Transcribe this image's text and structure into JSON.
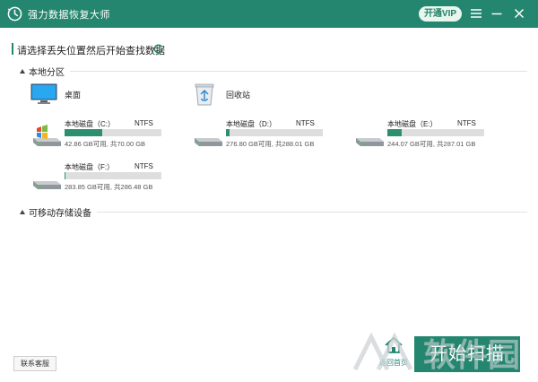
{
  "window": {
    "title": "强力数据恢复大师",
    "vip_label": "开通VIP",
    "logo_icon": "recovery-logo-icon",
    "menu_icon": "hamburger-menu-icon",
    "minimize_icon": "minimize-icon",
    "close_icon": "close-icon"
  },
  "header": {
    "prompt": "请选择丢失位置然后开始查找数据",
    "refresh_icon": "refresh-icon"
  },
  "local_section": {
    "label": "本地分区",
    "locations": [
      {
        "label": "桌面",
        "icon": "desktop-monitor-icon"
      },
      {
        "label": "回收站",
        "icon": "recycle-bin-icon"
      }
    ],
    "drives": [
      {
        "name": "本地磁盘（C:）",
        "fs": "NTFS",
        "size_text": "42.86 GB可用, 共70.00 GB",
        "used_fraction": 0.39,
        "icon": "windows-system-drive-icon"
      },
      {
        "name": "本地磁盘（D:）",
        "fs": "NTFS",
        "size_text": "276.80 GB可用, 共288.01 GB",
        "used_fraction": 0.04,
        "icon": "hard-drive-icon"
      },
      {
        "name": "本地磁盘（E:）",
        "fs": "NTFS",
        "size_text": "244.07 GB可用, 共287.01 GB",
        "used_fraction": 0.15,
        "icon": "hard-drive-icon"
      },
      {
        "name": "本地磁盘（F:）",
        "fs": "NTFS",
        "size_text": "283.85 GB可用, 共286.48 GB",
        "used_fraction": 0.01,
        "icon": "hard-drive-icon"
      }
    ]
  },
  "removable_section": {
    "label": "可移动存储设备"
  },
  "footer": {
    "support_label": "联系客服",
    "home_label": "返回首页",
    "home_icon": "home-icon",
    "scan_label": "开始扫描"
  },
  "watermark": {
    "text": "软件园"
  },
  "colors": {
    "brand": "#24866f",
    "progress": "#2c9070",
    "track": "#dedede"
  }
}
